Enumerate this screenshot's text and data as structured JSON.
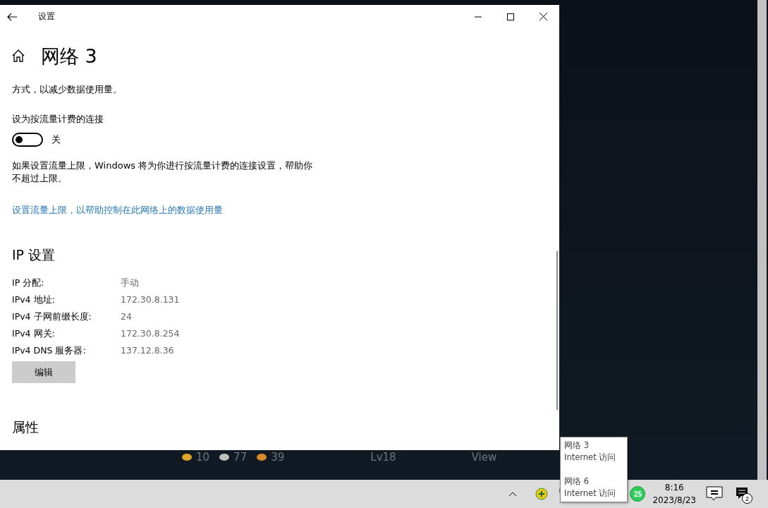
{
  "window": {
    "title": "设置",
    "page_title": "网络 3"
  },
  "intro_text": "方式，以减少数据使用量。",
  "metered": {
    "label": "设为按流量计费的连接",
    "on": false,
    "state_text": "关"
  },
  "metered_note": "如果设置流量上限，Windows 将为你进行按流量计费的连接设置，帮助你不超过上限。",
  "data_limit_link": "设置流量上限，以帮助控制在此网络上的数据使用量",
  "ip_settings": {
    "heading": "IP 设置",
    "rows": [
      {
        "label": "IP 分配:",
        "value": "手动"
      },
      {
        "label": "IPv4 地址:",
        "value": "172.30.8.131"
      },
      {
        "label": "IPv4 子网前缀长度:",
        "value": "24"
      },
      {
        "label": "IPv4 网关:",
        "value": "172.30.8.254"
      },
      {
        "label": "IPv4 DNS 服务器:",
        "value": "137.12.8.36"
      }
    ],
    "edit_button": "编辑"
  },
  "properties": {
    "heading": "属性"
  },
  "background_app": {
    "stats": [
      {
        "value": "10",
        "color": "#e0a526"
      },
      {
        "value": "77",
        "color": "#bfbfbf"
      },
      {
        "value": "39",
        "color": "#d98a2a"
      }
    ],
    "level": "Lv18",
    "action": "View"
  },
  "taskbar": {
    "time": "8:16",
    "date": "2023/8/23",
    "badge": "25",
    "notifications": "2"
  },
  "tooltip": {
    "entries": [
      {
        "name": "网络 3",
        "status": "Internet 访问"
      },
      {
        "name": "网络 6",
        "status": "Internet 访问"
      }
    ]
  }
}
